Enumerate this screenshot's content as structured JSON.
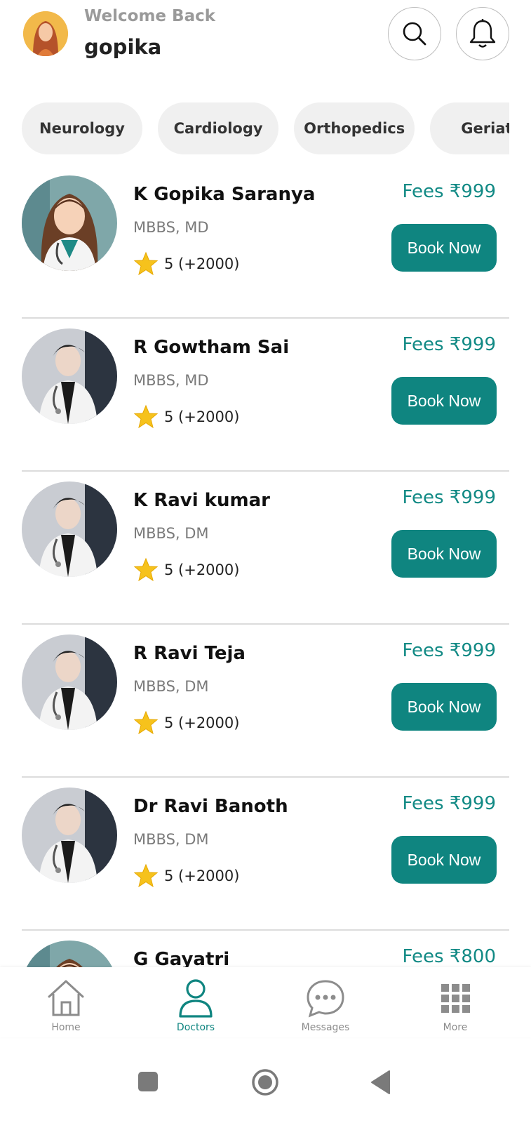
{
  "header": {
    "welcome": "Welcome Back",
    "username": "gopika"
  },
  "categories": [
    "Neurology",
    "Cardiology",
    "Orthopedics",
    "Geriatric"
  ],
  "doctors": [
    {
      "name": "K Gopika Saranya",
      "degree": "MBBS, MD",
      "rating": "5 (+2000)",
      "fees": "Fees ₹999",
      "book": "Book Now",
      "gender": "female"
    },
    {
      "name": "R Gowtham Sai",
      "degree": "MBBS, MD",
      "rating": "5 (+2000)",
      "fees": "Fees ₹999",
      "book": "Book Now",
      "gender": "male"
    },
    {
      "name": "K Ravi kumar",
      "degree": "MBBS, DM",
      "rating": "5 (+2000)",
      "fees": "Fees ₹999",
      "book": "Book Now",
      "gender": "male"
    },
    {
      "name": "R Ravi Teja",
      "degree": "MBBS, DM",
      "rating": "5 (+2000)",
      "fees": "Fees ₹999",
      "book": "Book Now",
      "gender": "male"
    },
    {
      "name": "Dr Ravi Banoth",
      "degree": "MBBS, DM",
      "rating": "5 (+2000)",
      "fees": "Fees ₹999",
      "book": "Book Now",
      "gender": "male"
    },
    {
      "name": "G Gayatri",
      "degree": "",
      "rating": "",
      "fees": "Fees ₹800",
      "book": "",
      "gender": "female"
    }
  ],
  "nav": [
    {
      "label": "Home",
      "icon": "home-icon",
      "active": false
    },
    {
      "label": "Doctors",
      "icon": "person-icon",
      "active": true
    },
    {
      "label": "Messages",
      "icon": "chat-bubble-icon",
      "active": false
    },
    {
      "label": "More",
      "icon": "grid-icon",
      "active": false
    }
  ],
  "colors": {
    "accent": "#0f8580",
    "chip_bg": "#f0f0f0",
    "star": "#f6c21c"
  }
}
